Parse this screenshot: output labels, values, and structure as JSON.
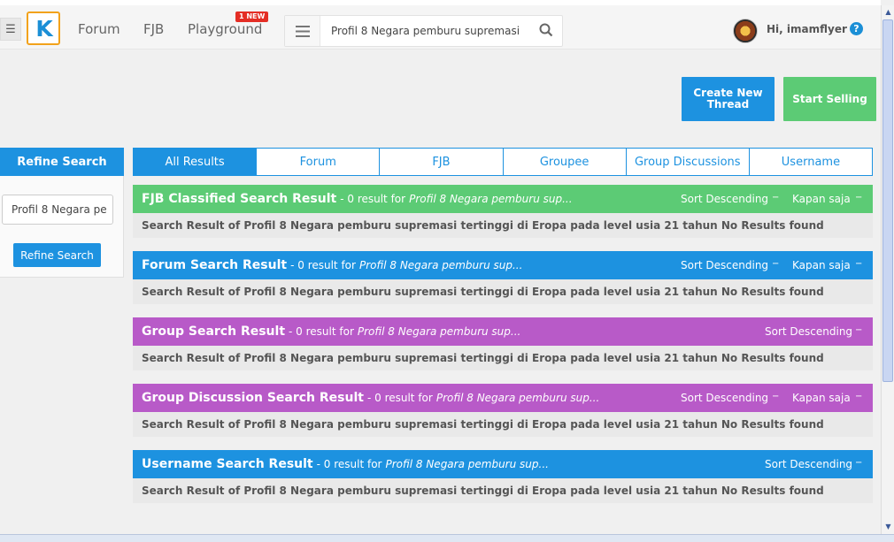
{
  "header": {
    "nav": [
      "Forum",
      "FJB",
      "Playground"
    ],
    "badge": "1 NEW",
    "search_value": "Profil 8 Negara pemburu supremasi te",
    "greeting": "Hi, imamflyer",
    "help": "?",
    "logo": "K"
  },
  "actions": {
    "create_label": "Create New Thread",
    "sell_label": "Start Selling"
  },
  "sidebar": {
    "title": "Refine Search",
    "input_value": "Profil 8 Negara pe",
    "button_label": "Refine Search"
  },
  "tabs": [
    "All Results",
    "Forum",
    "FJB",
    "Groupee",
    "Group Discussions",
    "Username"
  ],
  "sections": [
    {
      "title": "FJB Classified Search Result",
      "count": "- 0 result for",
      "query": "Profil 8 Negara pemburu sup...",
      "sort": "Sort Descending",
      "time": "Kapan saja",
      "message": "Search Result of Profil 8 Negara pemburu supremasi tertinggi di Eropa pada level usia 21 tahun No Results found",
      "color": "#5ccb75"
    },
    {
      "title": "Forum Search Result",
      "count": "- 0 result for",
      "query": "Profil 8 Negara pemburu sup...",
      "sort": "Sort Descending",
      "time": "Kapan saja",
      "message": "Search Result of Profil 8 Negara pemburu supremasi tertinggi di Eropa pada level usia 21 tahun No Results found",
      "color": "#1d92e0"
    },
    {
      "title": "Group Search Result",
      "count": "- 0 result for",
      "query": "Profil 8 Negara pemburu sup...",
      "sort": "Sort Descending",
      "message": "Search Result of Profil 8 Negara pemburu supremasi tertinggi di Eropa pada level usia 21 tahun No Results found",
      "color": "#b85ac8"
    },
    {
      "title": "Group Discussion Search Result",
      "count": "- 0 result for",
      "query": "Profil 8 Negara pemburu sup...",
      "sort": "Sort Descending",
      "time": "Kapan saja",
      "message": "Search Result of Profil 8 Negara pemburu supremasi tertinggi di Eropa pada level usia 21 tahun No Results found",
      "color": "#b85ac8"
    },
    {
      "title": "Username Search Result",
      "count": "- 0 result for",
      "query": "Profil 8 Negara pemburu sup...",
      "sort": "Sort Descending",
      "message": "Search Result of Profil 8 Negara pemburu supremasi tertinggi di Eropa pada level usia 21 tahun No Results found",
      "color": "#1d92e0"
    }
  ]
}
